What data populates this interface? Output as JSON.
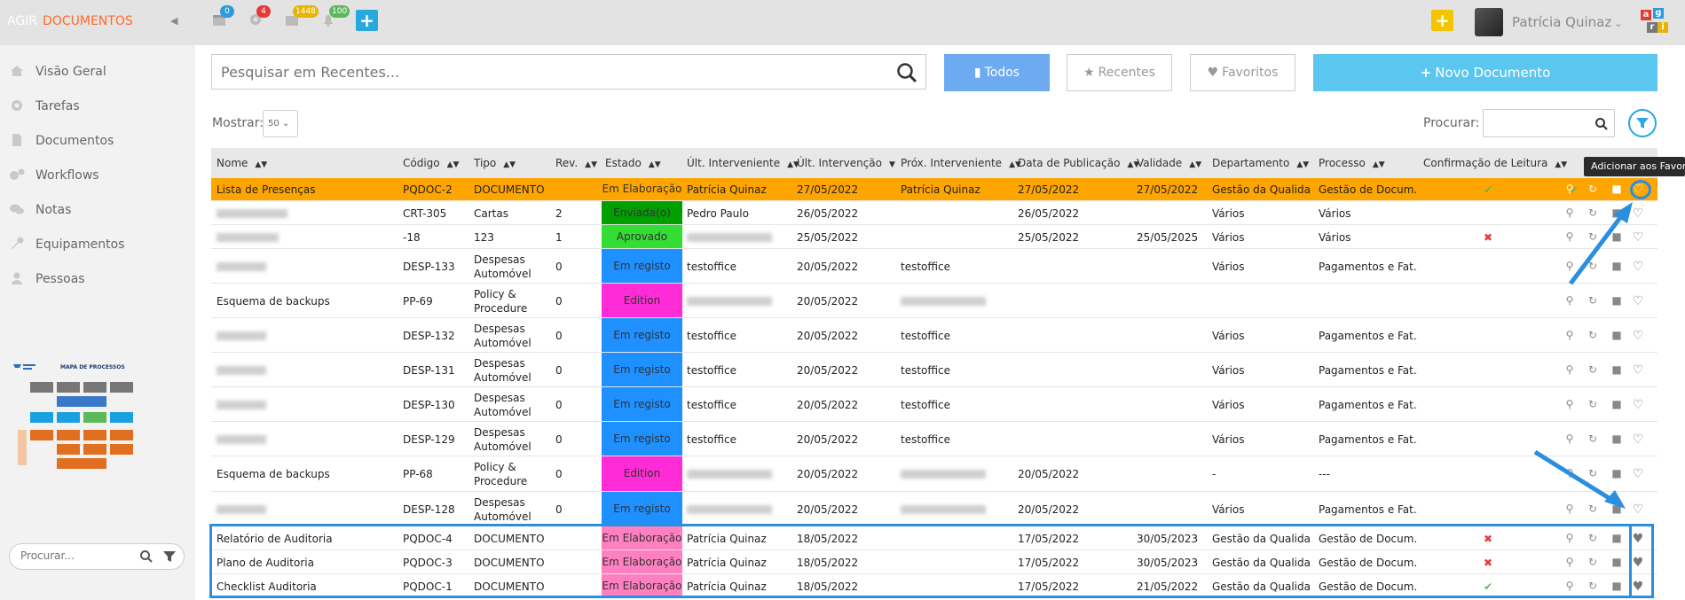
{
  "brand": {
    "agir": "AGIR",
    "documentos": "DOCUMENTOS"
  },
  "topbar": {
    "badges": [
      "0",
      "4",
      "1448",
      "100"
    ],
    "user_name": "Patrícia Quinaz",
    "colors": {
      "badge_blue": "#2a9be0",
      "badge_red": "#e53935",
      "badge_yellow": "#e8b400",
      "badge_green": "#5cb85c",
      "plus_blue": "#29a8e0",
      "plus_yellow": "#f5c400"
    }
  },
  "sidebar": {
    "items": [
      {
        "label": "Visão Geral",
        "icon": "home-icon"
      },
      {
        "label": "Tarefas",
        "icon": "gear-icon"
      },
      {
        "label": "Documentos",
        "icon": "file-icon"
      },
      {
        "label": "Workflows",
        "icon": "gears-icon"
      },
      {
        "label": "Notas",
        "icon": "comments-icon"
      },
      {
        "label": "Equipamentos",
        "icon": "wrench-icon"
      },
      {
        "label": "Pessoas",
        "icon": "user-icon"
      }
    ],
    "mapa_title": "MAPA DE PROCESSOS",
    "search_placeholder": "Procurar..."
  },
  "main": {
    "search_placeholder": "Pesquisar em Recentes...",
    "buttons": {
      "todos": "Todos",
      "recentes": "Recentes",
      "favoritos": "Favoritos",
      "novo": "Novo Documento"
    },
    "mostrar_label": "Mostrar:",
    "mostrar_value": "50",
    "procurar_label": "Procurar:",
    "tooltip": "Adicionar aos Favoritos"
  },
  "table": {
    "headers": [
      "Nome",
      "Código",
      "Tipo",
      "Rev.",
      "Estado",
      "Últ. Interveniente",
      "Últ. Intervenção",
      "Próx. Interveniente",
      "Data de Publicação",
      "Validade",
      "Departamento",
      "Processo",
      "Confirmação de Leitura"
    ],
    "rows": [
      {
        "nome": "Lista de Presenças",
        "codigo": "PQDOC-2",
        "tipo": "DOCUMENTO",
        "rev": "",
        "estado": "Em Elaboração",
        "estado_color": "#ffa500",
        "ult_int": "Patrícia Quinaz",
        "ult_data": "27/05/2022",
        "prox_int": "Patrícia Quinaz",
        "data_pub": "27/05/2022",
        "validade": "27/05/2022",
        "depto": "Gestão da Qualida...",
        "processo": "Gestão de Docum...",
        "conf": "check"
      },
      {
        "nome": "",
        "codigo": "CRT-305",
        "tipo": "Cartas",
        "rev": "2",
        "estado": "Enviada(o)",
        "estado_color": "#00a000",
        "ult_int": "Pedro Paulo",
        "ult_data": "26/05/2022",
        "prox_int": "",
        "data_pub": "26/05/2022",
        "validade": "",
        "depto": "Vários",
        "processo": "Vários",
        "conf": ""
      },
      {
        "nome": "",
        "codigo": "-18",
        "tipo": "123",
        "rev": "1",
        "estado": "Aprovado",
        "estado_color": "#33dd33",
        "ult_int": "",
        "ult_data": "25/05/2022",
        "prox_int": "",
        "data_pub": "25/05/2022",
        "validade": "25/05/2025",
        "depto": "Vários",
        "processo": "Vários",
        "conf": "cross"
      },
      {
        "nome": "",
        "codigo": "DESP-133",
        "tipo": "Despesas Automóvel",
        "rev": "0",
        "estado": "Em registo",
        "estado_color": "#1e90ff",
        "ult_int": "testoffice",
        "ult_data": "20/05/2022",
        "prox_int": "testoffice",
        "data_pub": "",
        "validade": "",
        "depto": "Vários",
        "processo": "Pagamentos e Fat...",
        "conf": ""
      },
      {
        "nome": "Esquema de backups",
        "codigo": "PP-69",
        "tipo": "Policy & Procedure",
        "rev": "0",
        "estado": "Edition",
        "estado_color": "#ff2bd6",
        "ult_int": "",
        "ult_data": "20/05/2022",
        "prox_int": "",
        "data_pub": "",
        "validade": "",
        "depto": "",
        "processo": "",
        "conf": ""
      },
      {
        "nome": "",
        "codigo": "DESP-132",
        "tipo": "Despesas Automóvel",
        "rev": "0",
        "estado": "Em registo",
        "estado_color": "#1e90ff",
        "ult_int": "testoffice",
        "ult_data": "20/05/2022",
        "prox_int": "testoffice",
        "data_pub": "",
        "validade": "",
        "depto": "Vários",
        "processo": "Pagamentos e Fat...",
        "conf": ""
      },
      {
        "nome": "",
        "codigo": "DESP-131",
        "tipo": "Despesas Automóvel",
        "rev": "0",
        "estado": "Em registo",
        "estado_color": "#1e90ff",
        "ult_int": "testoffice",
        "ult_data": "20/05/2022",
        "prox_int": "testoffice",
        "data_pub": "",
        "validade": "",
        "depto": "Vários",
        "processo": "Pagamentos e Fat...",
        "conf": ""
      },
      {
        "nome": "",
        "codigo": "DESP-130",
        "tipo": "Despesas Automóvel",
        "rev": "0",
        "estado": "Em registo",
        "estado_color": "#1e90ff",
        "ult_int": "testoffice",
        "ult_data": "20/05/2022",
        "prox_int": "testoffice",
        "data_pub": "",
        "validade": "",
        "depto": "Vários",
        "processo": "Pagamentos e Fat...",
        "conf": ""
      },
      {
        "nome": "",
        "codigo": "DESP-129",
        "tipo": "Despesas Automóvel",
        "rev": "0",
        "estado": "Em registo",
        "estado_color": "#1e90ff",
        "ult_int": "testoffice",
        "ult_data": "20/05/2022",
        "prox_int": "testoffice",
        "data_pub": "",
        "validade": "",
        "depto": "Vários",
        "processo": "Pagamentos e Fat...",
        "conf": ""
      },
      {
        "nome": "Esquema de backups",
        "codigo": "PP-68",
        "tipo": "Policy & Procedure",
        "rev": "0",
        "estado": "Edition",
        "estado_color": "#ff2bd6",
        "ult_int": "",
        "ult_data": "20/05/2022",
        "prox_int": "",
        "data_pub": "20/05/2022",
        "validade": "",
        "depto": "-",
        "processo": "---",
        "conf": ""
      },
      {
        "nome": "",
        "codigo": "DESP-128",
        "tipo": "Despesas Automóvel",
        "rev": "0",
        "estado": "Em registo",
        "estado_color": "#1e90ff",
        "ult_int": "",
        "ult_data": "20/05/2022",
        "prox_int": "",
        "data_pub": "20/05/2022",
        "validade": "",
        "depto": "Vários",
        "processo": "Pagamentos e Fat...",
        "conf": ""
      },
      {
        "nome": "Relatório de Auditoria",
        "codigo": "PQDOC-4",
        "tipo": "DOCUMENTO",
        "rev": "",
        "estado": "Em Elaboração",
        "estado_color": "#ff80c0",
        "ult_int": "Patrícia Quinaz",
        "ult_data": "18/05/2022",
        "prox_int": "",
        "data_pub": "17/05/2022",
        "validade": "30/05/2023",
        "depto": "Gestão da Qualida...",
        "processo": "Gestão de Docum...",
        "conf": "cross"
      },
      {
        "nome": "Plano de Auditoria",
        "codigo": "PQDOC-3",
        "tipo": "DOCUMENTO",
        "rev": "",
        "estado": "Em Elaboração",
        "estado_color": "#ff80c0",
        "ult_int": "Patrícia Quinaz",
        "ult_data": "18/05/2022",
        "prox_int": "",
        "data_pub": "17/05/2022",
        "validade": "30/05/2023",
        "depto": "Gestão da Qualida...",
        "processo": "Gestão de Docum...",
        "conf": "cross"
      },
      {
        "nome": "Checklist Auditoria",
        "codigo": "PQDOC-1",
        "tipo": "DOCUMENTO",
        "rev": "",
        "estado": "Em Elaboração",
        "estado_color": "#ff80c0",
        "ult_int": "Patrícia Quinaz",
        "ult_data": "18/05/2022",
        "prox_int": "",
        "data_pub": "17/05/2022",
        "validade": "21/05/2022",
        "depto": "Gestão da Qualida...",
        "processo": "Gestão de Docum...",
        "conf": "check"
      }
    ]
  }
}
